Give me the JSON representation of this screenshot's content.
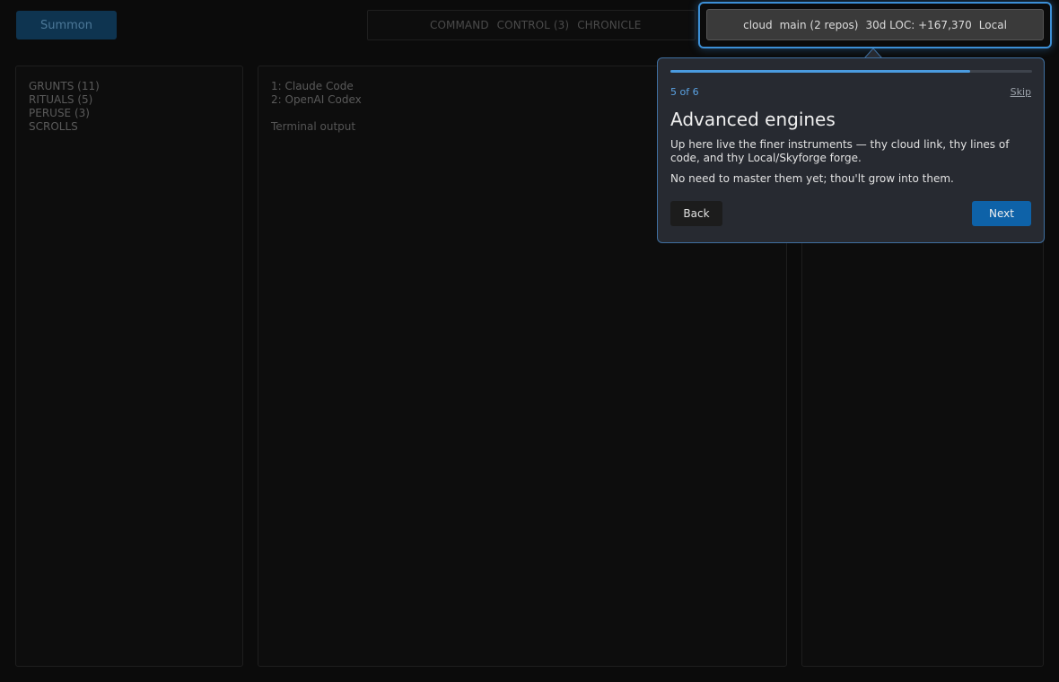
{
  "header": {
    "summon_label": "Summon",
    "tabs": [
      {
        "label": "COMMAND"
      },
      {
        "label": "CONTROL (3)"
      },
      {
        "label": "CHRONICLE"
      }
    ],
    "status": {
      "cloud": "cloud",
      "branch": "main (2 repos)",
      "loc": "30d LOC: +167,370",
      "mode": "Local"
    }
  },
  "sidebar": {
    "items": [
      {
        "label": "GRUNTS (11)"
      },
      {
        "label": "RITUALS (5)"
      },
      {
        "label": "PERUSE (3)"
      },
      {
        "label": "SCROLLS"
      }
    ]
  },
  "main": {
    "engines": [
      {
        "label": "1: Claude Code"
      },
      {
        "label": "2: OpenAI Codex"
      }
    ],
    "terminal_label": "Terminal output"
  },
  "tour": {
    "progress": 0.83,
    "step_text": "5 of 6",
    "skip_label": "Skip",
    "title": "Advanced engines",
    "body": "Up here live the finer instruments — thy cloud link, thy lines of code, and thy Local/Skyforge forge.",
    "body2": "No need to master them yet; thou'lt grow into them.",
    "back_label": "Back",
    "next_label": "Next"
  },
  "colors": {
    "accent": "#3c8fd6",
    "primary_button": "#0e62a8",
    "background": "#0b0b0b"
  }
}
